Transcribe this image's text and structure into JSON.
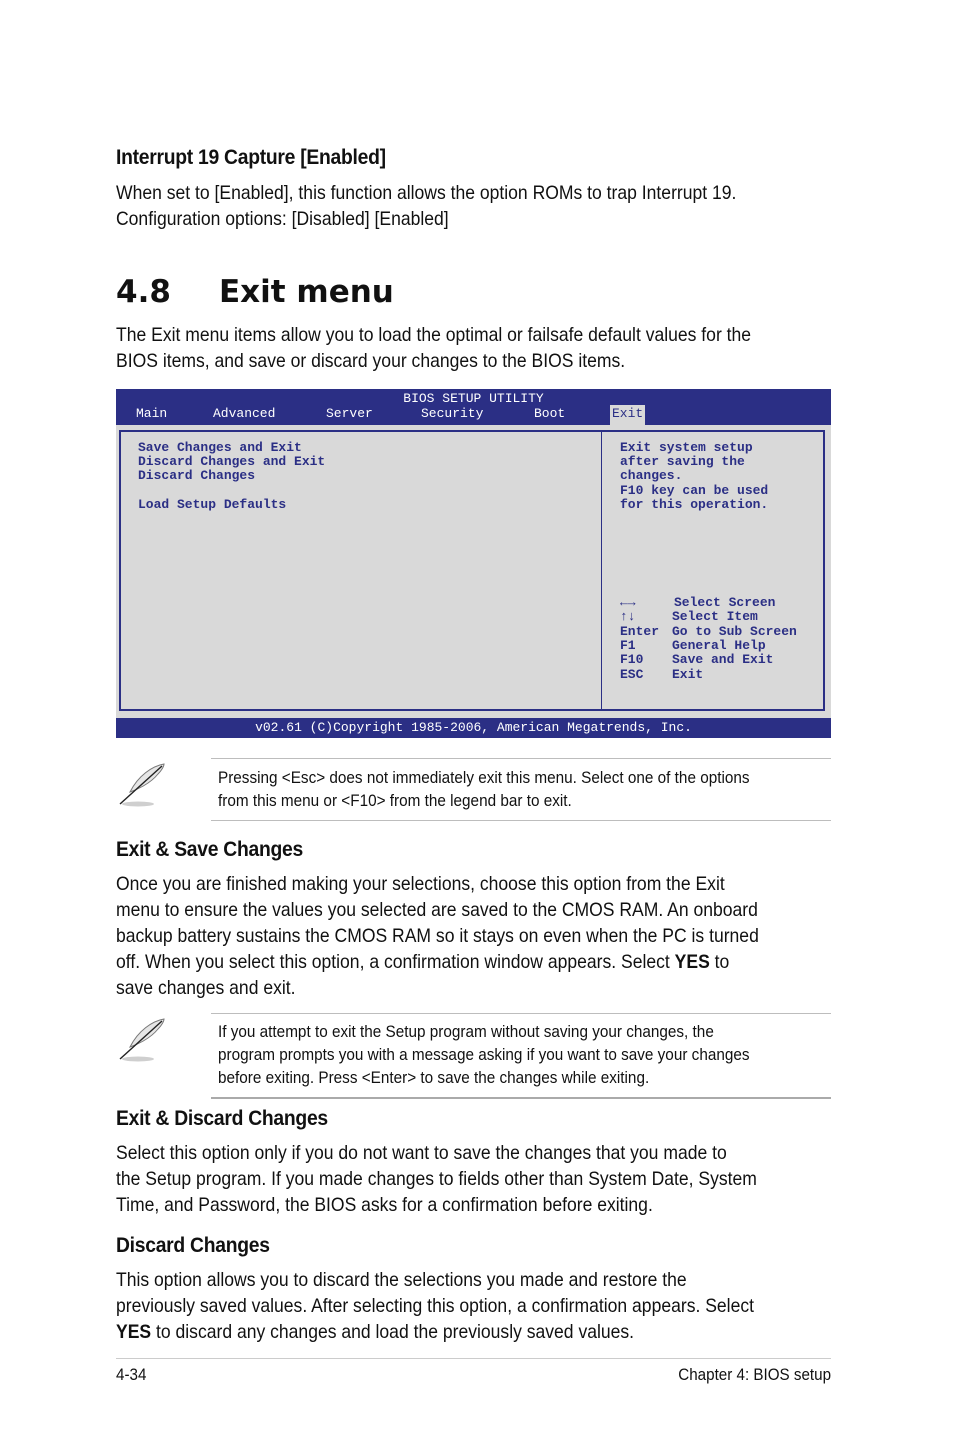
{
  "section_interrupt": {
    "heading": "Interrupt 19 Capture [Enabled]",
    "lines": [
      "When set to [Enabled], this function allows the option ROMs to trap Interrupt 19.",
      "Configuration options: [Disabled] [Enabled]"
    ]
  },
  "section_exit_menu": {
    "number": "4.8",
    "title": "Exit menu",
    "intro_lines": [
      "The Exit menu items allow you to load the optimal or failsafe default values for the",
      "BIOS items, and save or discard your changes to the BIOS items."
    ]
  },
  "bios": {
    "title": "BIOS SETUP UTILITY",
    "tabs": [
      {
        "label": "Main",
        "active": false
      },
      {
        "label": "Advanced",
        "active": false
      },
      {
        "label": "Server",
        "active": false
      },
      {
        "label": "Security",
        "active": false
      },
      {
        "label": "Boot",
        "active": false
      },
      {
        "label": "Exit",
        "active": true
      }
    ],
    "menu_items": [
      "Save Changes and Exit",
      "Discard Changes and Exit",
      "Discard Changes",
      "Load Setup Defaults"
    ],
    "help_lines": [
      "Exit system setup",
      "after saving the",
      "changes.",
      "F10 key can be used",
      "for this operation."
    ],
    "legend": [
      {
        "key": "←→",
        "desc": "Select Screen"
      },
      {
        "key": "↑↓",
        "desc": "Select Item"
      },
      {
        "key": "Enter",
        "desc": "Go to Sub Screen"
      },
      {
        "key": "F1",
        "desc": "General Help"
      },
      {
        "key": "F10",
        "desc": "Save and Exit"
      },
      {
        "key": "ESC",
        "desc": "Exit"
      }
    ],
    "footer": "v02.61 (C)Copyright 1985-2006, American Megatrends, Inc.",
    "colors": {
      "bar": "#2b2f85",
      "panel": "#d9d9d9",
      "text": "#2b2f85"
    }
  },
  "notes": [
    {
      "icon": "feather-pen-icon",
      "lines": [
        "Pressing <Esc> does not immediately exit this menu. Select one of the options",
        "from this menu or <F10> from the legend bar to exit."
      ]
    },
    {
      "icon": "feather-pen-icon",
      "lines": [
        "If you attempt to exit the Setup program without saving your changes, the",
        "program prompts you with a message asking if you want to save your changes",
        "before exiting. Press <Enter> to save the changes while exiting."
      ]
    }
  ],
  "section_exit_save": {
    "heading": "Exit & Save Changes",
    "lines": [
      "Once you are finished making your selections, choose this option from the Exit",
      "menu to ensure the values you selected are saved to the CMOS RAM. An onboard",
      "backup battery sustains the CMOS RAM so it stays on even when the PC is turned",
      "off. When you select this option, a confirmation window appears. Select ",
      "save changes and exit."
    ],
    "bold_word": "YES",
    "after_bold": " to"
  },
  "section_exit_discard": {
    "heading": "Exit & Discard Changes",
    "lines": [
      "Select this option only if you do not want to save the changes that you  made to",
      "the Setup program. If you made changes to fields other than System Date, System",
      "Time, and Password, the BIOS asks for a confirmation before exiting."
    ]
  },
  "section_discard": {
    "heading": "Discard Changes",
    "lines": [
      "This option allows you to discard the selections you made and restore the",
      "previously saved values. After selecting this option, a confirmation appears. Select",
      " to discard any changes and load the previously saved values."
    ],
    "bold_word": "YES"
  },
  "footer": {
    "page_number": "4-34",
    "chapter": "Chapter 4: BIOS setup"
  }
}
